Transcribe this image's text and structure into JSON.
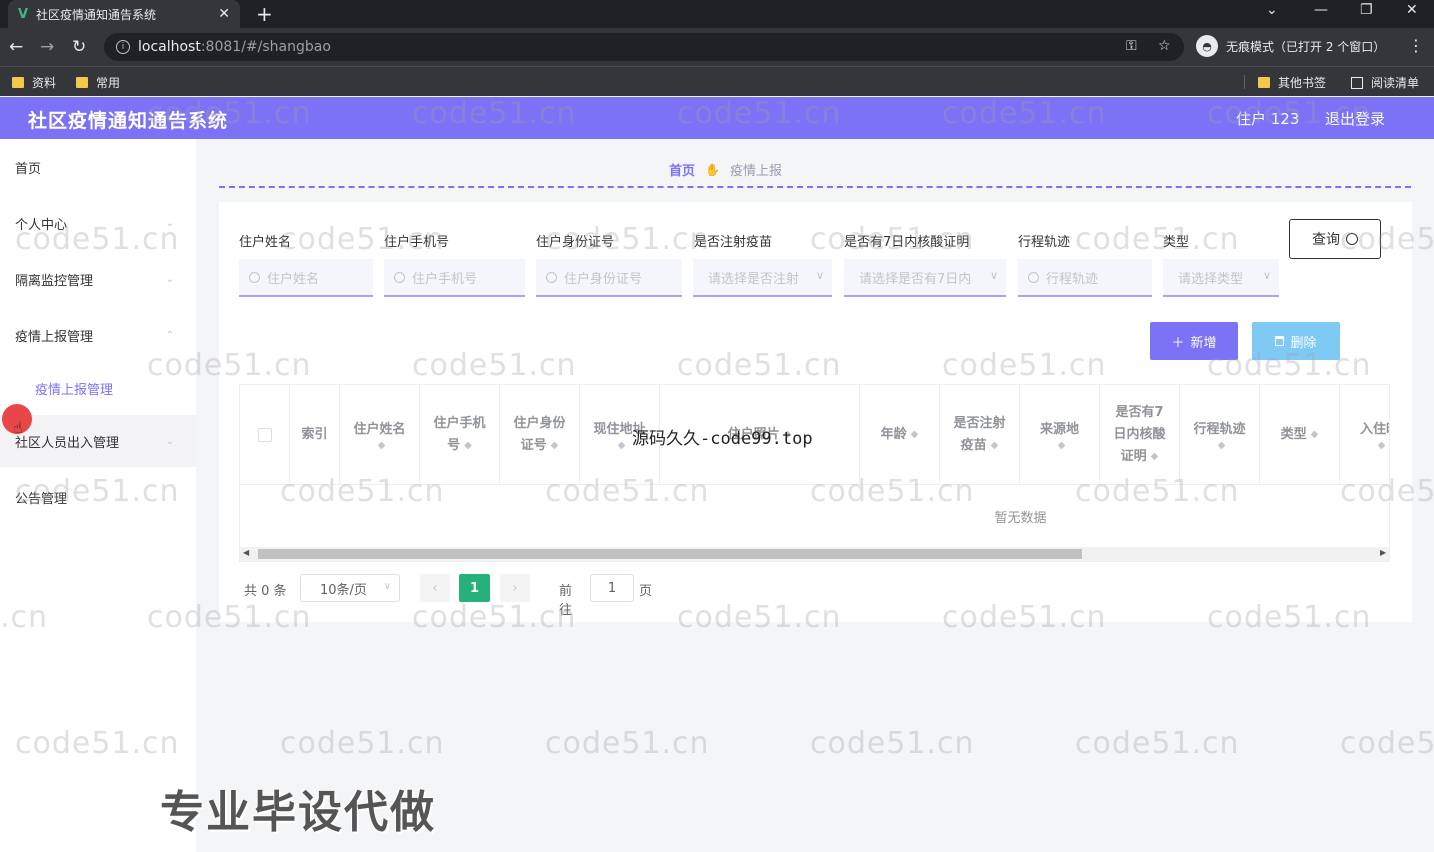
{
  "browser": {
    "tab_title": "社区疫情通知通告系统",
    "url_host": "localhost",
    "url_rest": ":8081/#/shangbao",
    "incognito_label": "无痕模式（已打开 2 个窗口）",
    "bookmarks": [
      "资料",
      "常用"
    ],
    "other_bookmarks": "其他书签",
    "reading_list": "阅读清单"
  },
  "header": {
    "title": "社区疫情通知通告系统",
    "user": "住户 123",
    "logout": "退出登录"
  },
  "sidebar": {
    "items": [
      {
        "label": "首页"
      },
      {
        "label": "个人中心"
      },
      {
        "label": "隔离监控管理"
      },
      {
        "label": "疫情上报管理"
      },
      {
        "label": "社区人员出入管理"
      },
      {
        "label": "公告管理"
      }
    ],
    "sub_item": "疫情上报管理"
  },
  "breadcrumb": {
    "home": "首页",
    "current": "疫情上报"
  },
  "search": {
    "fields": [
      {
        "label": "住户姓名",
        "placeholder": "住户姓名"
      },
      {
        "label": "住户手机号",
        "placeholder": "住户手机号"
      },
      {
        "label": "住户身份证号",
        "placeholder": "住户身份证号"
      },
      {
        "label": "是否注射疫苗",
        "placeholder": "请选择是否注射"
      },
      {
        "label": "是否有7日内核酸证明",
        "placeholder": "请选择是否有7日内"
      },
      {
        "label": "行程轨迹",
        "placeholder": "行程轨迹"
      },
      {
        "label": "类型",
        "placeholder": "请选择类型"
      }
    ],
    "query_button": "查询"
  },
  "actions": {
    "add": "新增",
    "delete": "删除"
  },
  "table": {
    "columns": [
      {
        "line1": "索引",
        "line2": "",
        "line3": ""
      },
      {
        "line1": "住户姓名",
        "line2": "",
        "line3": ""
      },
      {
        "line1": "住户手机",
        "line2": "号",
        "line3": ""
      },
      {
        "line1": "住户身份",
        "line2": "证号",
        "line3": ""
      },
      {
        "line1": "现住地址",
        "line2": "",
        "line3": ""
      },
      {
        "line1": "住户照片",
        "line2": "",
        "line3": ""
      },
      {
        "line1": "年龄",
        "line2": "",
        "line3": ""
      },
      {
        "line1": "是否注射",
        "line2": "疫苗",
        "line3": ""
      },
      {
        "line1": "来源地",
        "line2": "",
        "line3": ""
      },
      {
        "line1": "是否有7",
        "line2": "日内核酸",
        "line3": "证明"
      },
      {
        "line1": "行程轨迹",
        "line2": "",
        "line3": ""
      },
      {
        "line1": "类型",
        "line2": "",
        "line3": ""
      },
      {
        "line1": "入住时",
        "line2": "",
        "line3": ""
      }
    ],
    "empty_text": "暂无数据"
  },
  "pagination": {
    "total": "共 0 条",
    "page_size": "10条/页",
    "current_page": "1",
    "goto_label": "前往",
    "goto_value": "1",
    "page_suffix": "页"
  },
  "overlays": {
    "watermark": "code51.cn",
    "watermark_partial_left": ".cn",
    "watermark_partial_right": "code5",
    "mid_text": "源码久久-code99.top",
    "promo": "专业毕设代做"
  },
  "colors": {
    "primary": "#7c72f5",
    "delete_button": "#7fc9f5",
    "active_page": "#26b07a"
  }
}
